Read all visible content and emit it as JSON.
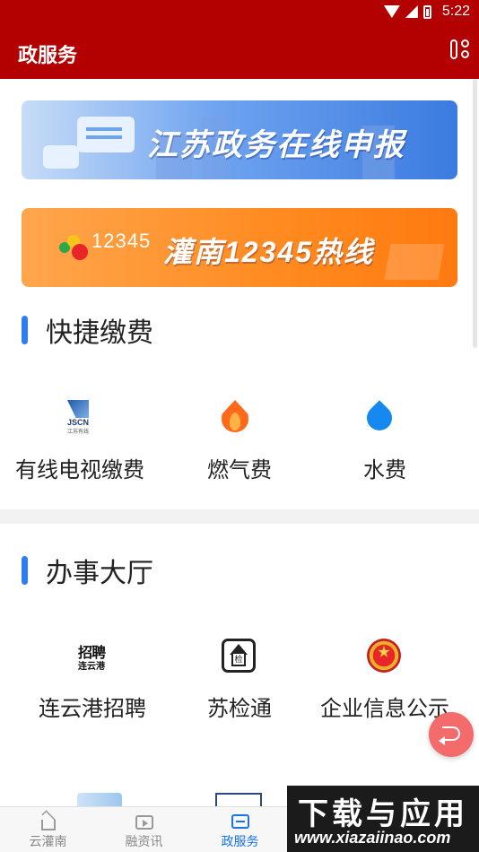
{
  "status_bar": {
    "time": "5:22"
  },
  "app_bar": {
    "title": "政服务"
  },
  "banners": [
    {
      "text": "江苏政务在线申报"
    },
    {
      "logo_text": "12345",
      "text": "灌南12345热线"
    }
  ],
  "quick_pay": {
    "title": "快捷缴费",
    "items": [
      {
        "label": "有线电视缴费",
        "icon": "jscn-logo-icon",
        "icon_text": "JSCN",
        "icon_sub": "江苏有线"
      },
      {
        "label": "燃气费",
        "icon": "flame-icon"
      },
      {
        "label": "水费",
        "icon": "water-drop-icon"
      }
    ]
  },
  "service_hall": {
    "title": "办事大厅",
    "items": [
      {
        "label": "连云港招聘",
        "icon": "recruitment-logo-icon",
        "icon_text": "招聘",
        "icon_sub": "连云港"
      },
      {
        "label": "苏检通",
        "icon": "inspection-house-icon",
        "icon_text": "检"
      },
      {
        "label": "企业信息公示",
        "icon": "national-emblem-icon"
      }
    ]
  },
  "tabbar": {
    "tabs": [
      {
        "label": "云灌南",
        "icon": "home-icon"
      },
      {
        "label": "融资讯",
        "icon": "video-icon"
      },
      {
        "label": "政服务",
        "icon": "chat-icon",
        "active": true
      }
    ]
  },
  "watermark": {
    "line1": "下载与应用",
    "line2": "www.xiazaiinao.com"
  },
  "colors": {
    "primary_red": "#b30000",
    "accent_blue": "#2f7df6",
    "active_tab": "#1a73e8",
    "fab": "#f46b6b"
  }
}
